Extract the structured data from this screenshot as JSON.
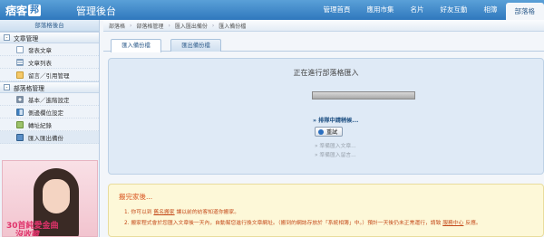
{
  "header": {
    "logo_text": "痞客",
    "logo_box": "邦",
    "app_title": "管理後台",
    "nav": [
      "管理首頁",
      "應用市集",
      "名片",
      "好友互動",
      "相簿",
      "部落格"
    ]
  },
  "sidebar": {
    "heading": "部落格後台",
    "sections": [
      {
        "title": "文章管理",
        "toggle": "-",
        "items": [
          {
            "label": "發表文章",
            "icon": "doc-icon"
          },
          {
            "label": "文章列表",
            "icon": "list-icon"
          },
          {
            "label": "留言／引用管理",
            "icon": "chat-icon"
          }
        ]
      },
      {
        "title": "部落格管理",
        "toggle": "-",
        "items": [
          {
            "label": "基本／進階設定",
            "icon": "gear-icon"
          },
          {
            "label": "側邊欄位設定",
            "icon": "layout-icon"
          },
          {
            "label": "轉址紀錄",
            "icon": "log-icon"
          },
          {
            "label": "匯入匯出備份",
            "icon": "import-icon"
          }
        ]
      }
    ],
    "ad": {
      "line1": "30首純愛金曲",
      "line2": "沒收藏"
    }
  },
  "breadcrumb": [
    "部落格",
    "部落格管理",
    "匯入匯出備份",
    "匯入備份檔"
  ],
  "tabs": [
    "匯入備份檔",
    "匯出備份檔"
  ],
  "import_panel": {
    "title": "正在進行部落格匯入",
    "status_heading": "» 排隊中請稍候...",
    "retry_label": "重試",
    "steps": [
      "» 準備匯入文章...",
      "» 準備匯入留言..."
    ]
  },
  "notice": {
    "title": "搬完家後...",
    "lines": [
      {
        "prefix": "1.  你可以到 ",
        "link": "舊名搬家",
        "suffix": " 讓以前的訪客知道你搬家。"
      },
      {
        "prefix": "2.  搬家程式會於您匯入文章後一天內，自動幫您進行換文章網址。（搬到的網誌存放於「系統相簿」中。）預計一天後仍未正常運行，請致 ",
        "link": "服務中心",
        "suffix": " 反應。"
      }
    ]
  }
}
